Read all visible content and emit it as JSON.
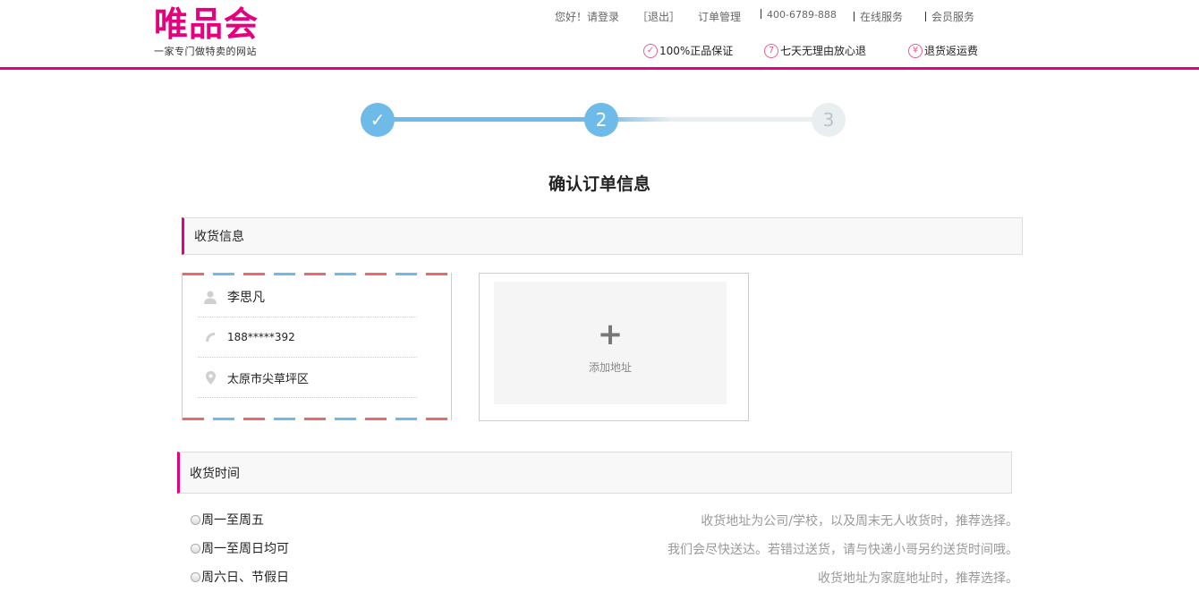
{
  "brand": {
    "logo": "唯品会",
    "tagline": "一家专门做特卖的网站",
    "accent_color": "#e4007f"
  },
  "topnav": {
    "greeting": "您好！请登录",
    "logout": "［退出］",
    "orders": "订单管理",
    "phone": "400-6789-888",
    "online_service": "在线服务",
    "member_service": "会员服务"
  },
  "badges": [
    {
      "icon": "check-circle-icon",
      "glyph": "✓",
      "label": "100%正品保证"
    },
    {
      "icon": "seven-circle-icon",
      "glyph": "7",
      "label": "七天无理由放心退"
    },
    {
      "icon": "yen-circle-icon",
      "glyph": "¥",
      "label": "退货返运费"
    }
  ],
  "steps": {
    "step1": "✓",
    "step2": "2",
    "step3": "3",
    "current": 2,
    "active_color": "#6ebae8"
  },
  "page_title": "确认订单信息",
  "shipping_info": {
    "section_title": "收货信息",
    "address": {
      "name": "李思凡",
      "phone": "188*****392",
      "location": "太原市尖草坪区"
    },
    "add_address": {
      "plus": "+",
      "label": "添加地址"
    }
  },
  "delivery_time": {
    "section_title": "收货时间",
    "options": [
      {
        "label": "周一至周五",
        "hint": "收货地址为公司/学校，以及周末无人收货时，推荐选择。"
      },
      {
        "label": "周一至周日均可",
        "hint": "我们会尽快送达。若错过送货，请与快递小哥另约送货时间哦。"
      },
      {
        "label": "周六日、节假日",
        "hint": "收货地址为家庭地址时，推荐选择。"
      }
    ]
  }
}
